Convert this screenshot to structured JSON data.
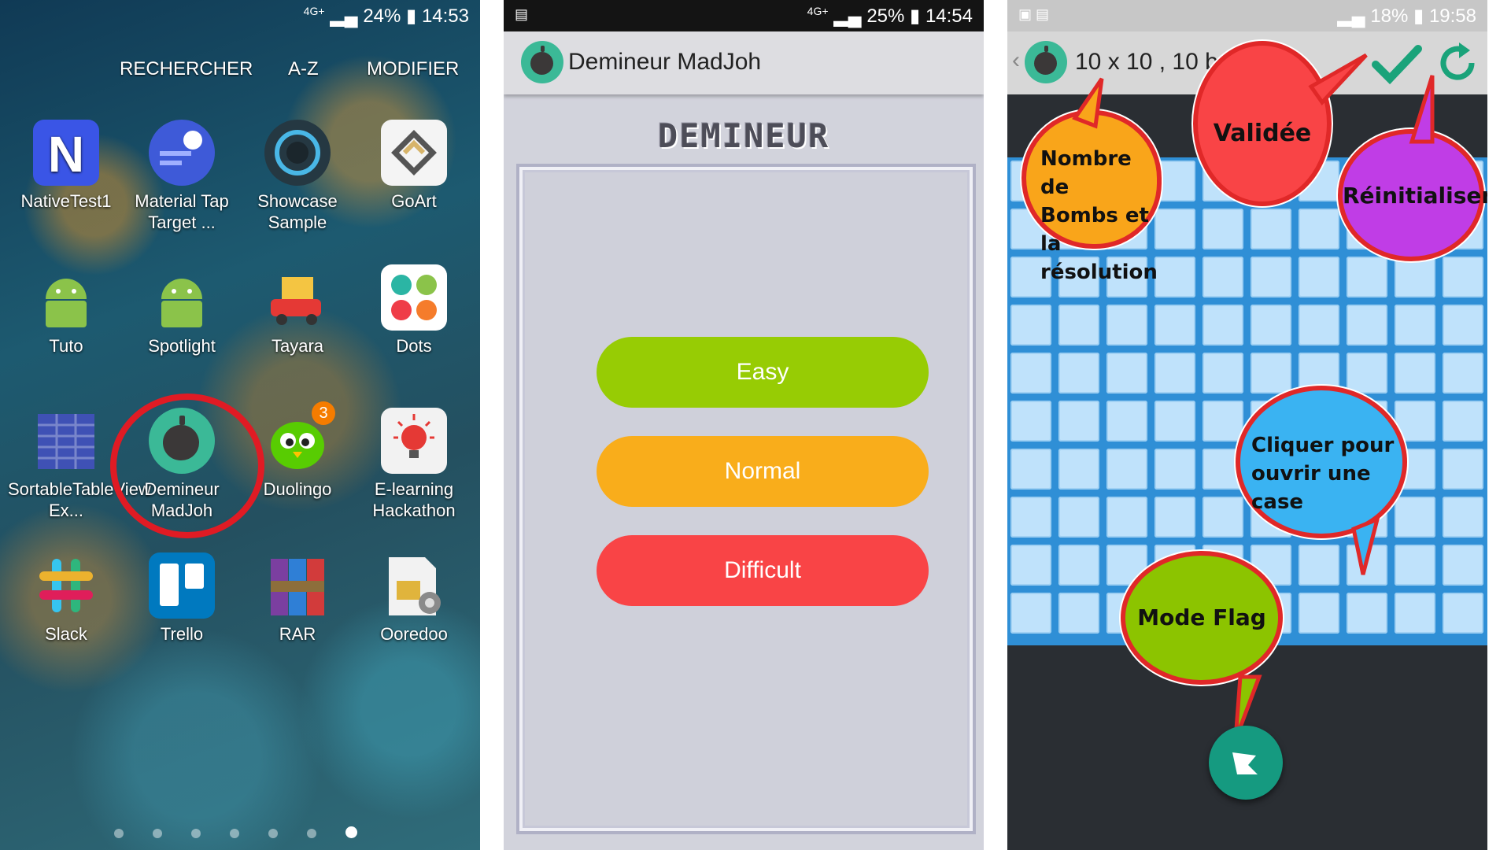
{
  "launcher": {
    "status": {
      "network": "4G+",
      "battery": "24%",
      "time": "14:53"
    },
    "menu": {
      "search": "RECHERCHER",
      "az": "A-Z",
      "edit": "MODIFIER"
    },
    "apps": [
      {
        "label": "NativeTest1",
        "icon": "native-n-icon"
      },
      {
        "label": "Material Tap Target ...",
        "icon": "material-icon"
      },
      {
        "label": "Showcase Sample",
        "icon": "showcase-icon"
      },
      {
        "label": "GoArt",
        "icon": "goart-icon"
      },
      {
        "label": "Tuto",
        "icon": "android-icon"
      },
      {
        "label": "Spotlight",
        "icon": "android-icon"
      },
      {
        "label": "Tayara",
        "icon": "tayara-icon"
      },
      {
        "label": "Dots",
        "icon": "dots-icon"
      },
      {
        "label": "SortableTableView Ex...",
        "icon": "sortable-icon"
      },
      {
        "label": "Demineur MadJoh",
        "icon": "bomb-icon"
      },
      {
        "label": "Duolingo",
        "icon": "duolingo-icon",
        "badge": "3"
      },
      {
        "label": "E-learning Hackathon",
        "icon": "bulb-icon"
      },
      {
        "label": "Slack",
        "icon": "slack-icon"
      },
      {
        "label": "Trello",
        "icon": "trello-icon"
      },
      {
        "label": "RAR",
        "icon": "rar-icon"
      },
      {
        "label": "Ooredoo",
        "icon": "sim-icon"
      }
    ],
    "page_count": 7,
    "current_page": 7,
    "highlight_color": "#e01b24"
  },
  "menu_screen": {
    "status": {
      "network": "4G+",
      "battery": "25%",
      "time": "14:54"
    },
    "title": "Demineur MadJoh",
    "heading": "DEMINEUR",
    "buttons": [
      {
        "label": "Easy",
        "color": "#97cc04"
      },
      {
        "label": "Normal",
        "color": "#f9ad1b"
      },
      {
        "label": "Difficult",
        "color": "#f94446"
      }
    ]
  },
  "game_screen": {
    "status": {
      "battery": "18%",
      "time": "19:58"
    },
    "title": "10 x 10 , 10 b",
    "annotations": {
      "bombs": "Nombre de Bombs et la résolution",
      "validated": "Validée",
      "reset": "Réinitialiser",
      "click": "Cliquer pour ouvrir une case",
      "flag": "Mode Flag"
    },
    "bubble_colors": {
      "bombs": "#f9a51a",
      "validated": "#f94446",
      "reset": "#c03de6",
      "click": "#3ab3f2",
      "flag": "#8cc400"
    },
    "grid": {
      "rows": 10,
      "cols": 10
    }
  }
}
